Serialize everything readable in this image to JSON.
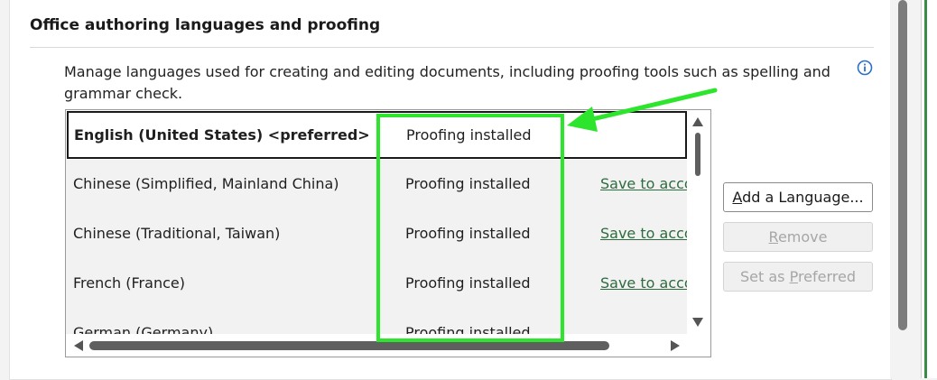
{
  "section": {
    "title": "Office authoring languages and proofing",
    "description": "Manage languages used for creating and editing documents, including proofing tools such as spelling and grammar check."
  },
  "languages": [
    {
      "name": "English (United States) <preferred>",
      "status": "Proofing installed",
      "action": ""
    },
    {
      "name": "Chinese (Simplified, Mainland China)",
      "status": "Proofing installed",
      "action": "Save to account"
    },
    {
      "name": "Chinese (Traditional, Taiwan)",
      "status": "Proofing installed",
      "action": "Save to account"
    },
    {
      "name": "French (France)",
      "status": "Proofing installed",
      "action": "Save to account"
    },
    {
      "name": "German (Germany)",
      "status": "Proofing installed",
      "action": ""
    }
  ],
  "buttons": {
    "add": {
      "pre": "",
      "accel": "A",
      "post": "dd a Language..."
    },
    "remove": {
      "pre": "",
      "accel": "R",
      "post": "emove"
    },
    "set_preferred": {
      "pre": "Set as ",
      "accel": "P",
      "post": "referred"
    }
  },
  "colors": {
    "annotation": "#2ee52e",
    "link": "#2e6b3f"
  }
}
